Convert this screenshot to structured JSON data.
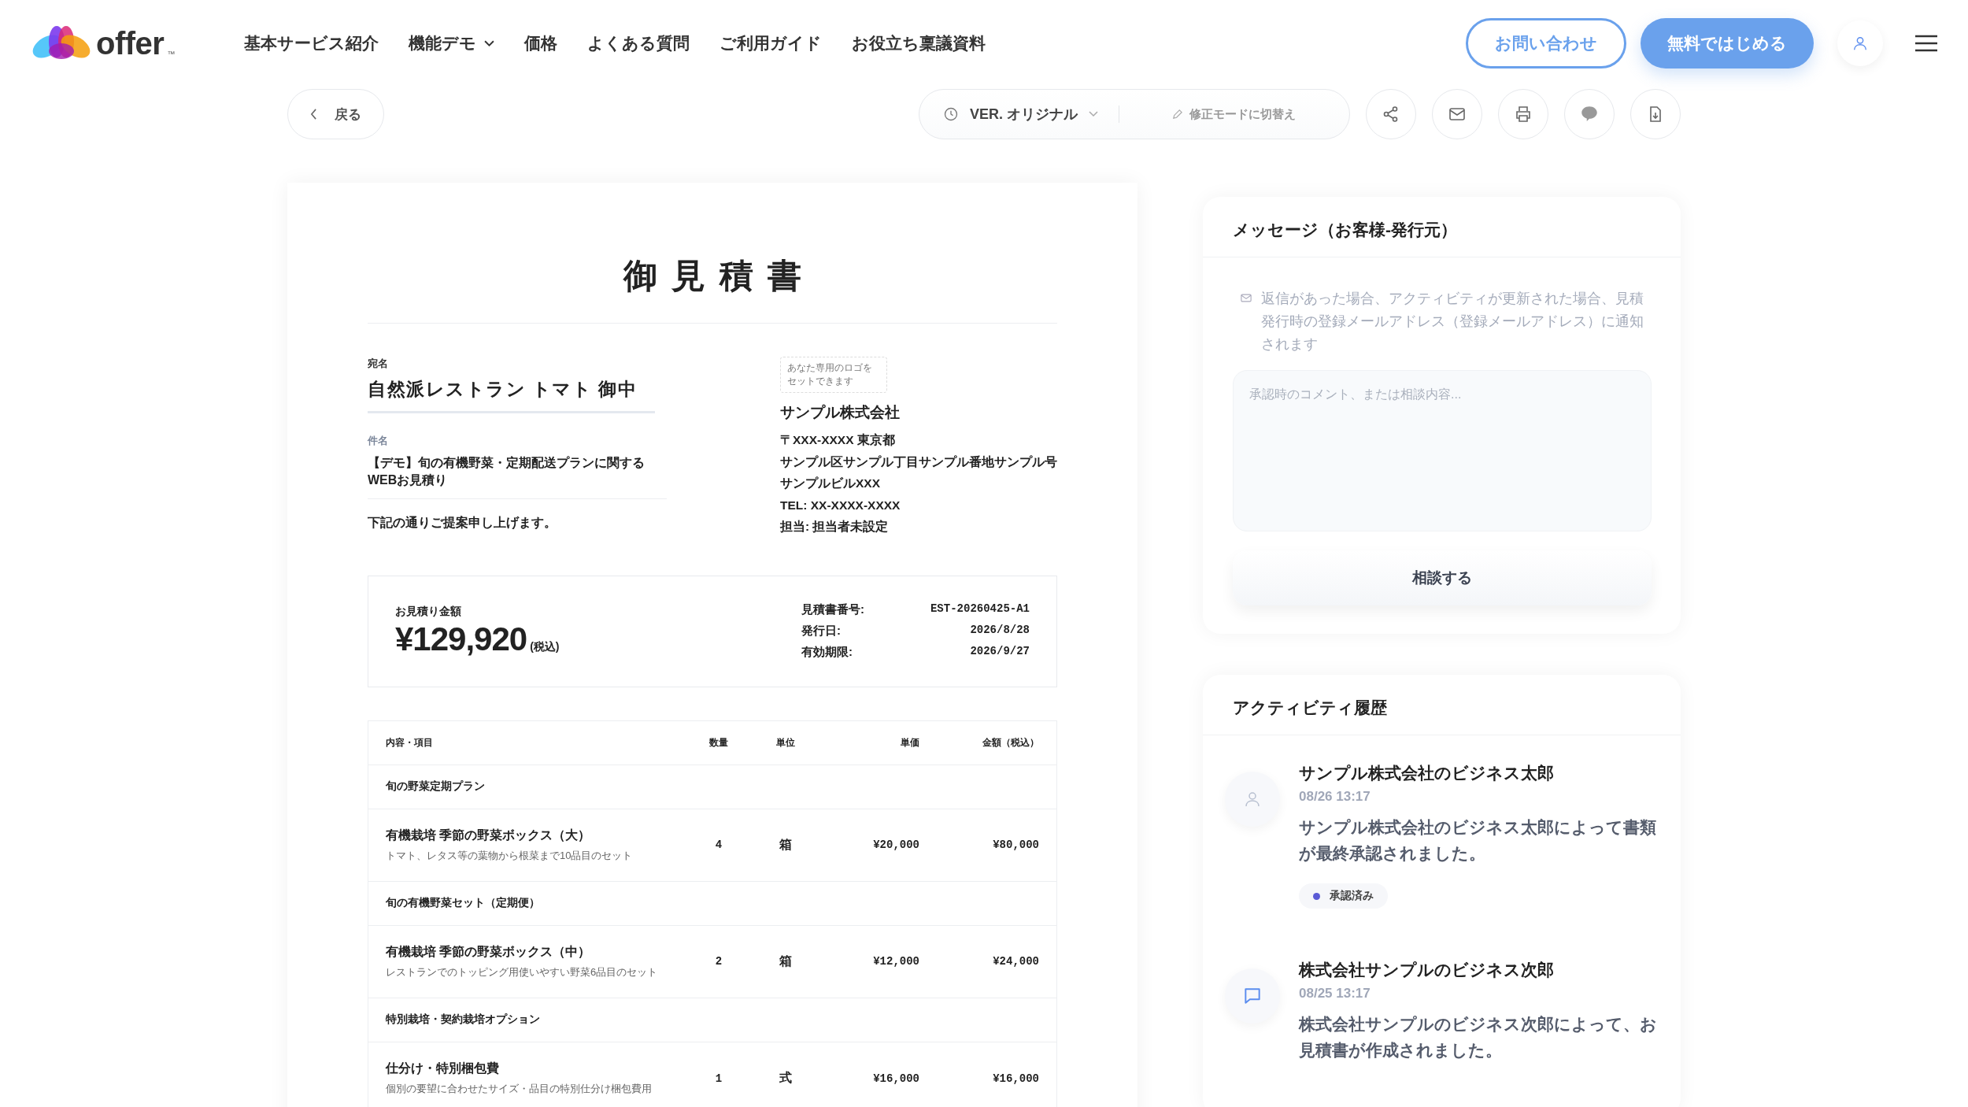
{
  "header": {
    "logo": "offer",
    "logo_mark": "™",
    "nav": [
      {
        "label": "基本サービス紹介",
        "has_menu": false
      },
      {
        "label": "機能デモ",
        "has_menu": true
      },
      {
        "label": "価格",
        "has_menu": false
      },
      {
        "label": "よくある質問",
        "has_menu": false
      },
      {
        "label": "ご利用ガイド",
        "has_menu": false
      },
      {
        "label": "お役立ち稟議資料",
        "has_menu": false
      }
    ],
    "contact_button": "お問い合わせ",
    "start_button": "無料ではじめる"
  },
  "toolbar": {
    "back": "戻る",
    "version": "VER. オリジナル",
    "edit_mode": "修正モードに切替え"
  },
  "document": {
    "title": "御見積書",
    "recipient_label": "宛名",
    "recipient": "自然派レストラン トマト 御中",
    "subject_label": "件名",
    "subject": "【デモ】旬の有機野菜・定期配送プランに関するWEBお見積り",
    "intro": "下記の通りご提案申し上げます。",
    "logo_placeholder": "あなた専用のロゴをセットできます",
    "company": "サンプル株式会社",
    "address_lines": [
      "〒XXX-XXXX 東京都",
      "サンプル区サンプル丁目サンプル番地サンプル号",
      "サンプルビルXXX",
      "TEL: XX-XXXX-XXXX",
      "担当: 担当者未設定"
    ],
    "amount_label": "お見積り金額",
    "amount": "¥129,920",
    "tax_note": "(税込)",
    "meta": [
      {
        "label": "見積書番号:",
        "value": "EST-20260425-A1"
      },
      {
        "label": "発行日:",
        "value": "2026/8/28"
      },
      {
        "label": "有効期限:",
        "value": "2026/9/27"
      }
    ],
    "table": {
      "columns": [
        "内容・項目",
        "数量",
        "単位",
        "単価",
        "金額（税込）"
      ],
      "rows": [
        {
          "kind": "group",
          "label": "旬の野菜定期プラン"
        },
        {
          "kind": "item",
          "name": "有機栽培 季節の野菜ボックス（大）",
          "note": "トマト、レタス等の葉物から根菜まで10品目のセット",
          "qty": "4",
          "unit": "箱",
          "price": "¥20,000",
          "amount": "¥80,000"
        },
        {
          "kind": "group",
          "label": "旬の有機野菜セット（定期便）"
        },
        {
          "kind": "item",
          "name": "有機栽培 季節の野菜ボックス（中）",
          "note": "レストランでのトッピング用使いやすい野菜6品目のセット",
          "qty": "2",
          "unit": "箱",
          "price": "¥12,000",
          "amount": "¥24,000"
        },
        {
          "kind": "group",
          "label": "特別栽培・契約栽培オプション"
        },
        {
          "kind": "item",
          "name": "仕分け・特別梱包費",
          "note": "個別の要望に合わせたサイズ・品目の特別仕分け梱包費用",
          "qty": "1",
          "unit": "式",
          "price": "¥16,000",
          "amount": "¥16,000"
        }
      ]
    }
  },
  "messages": {
    "title": "メッセージ（お客様-発行元）",
    "notice": "返信があった場合、アクティビティが更新された場合、見積発行時の登録メールアドレス（登録メールアドレス）に通知されます",
    "placeholder": "承認時のコメント、または相談内容...",
    "button": "相談する"
  },
  "activity": {
    "title": "アクティビティ履歴",
    "entries": [
      {
        "kind": "person",
        "name": "サンプル株式会社のビジネス太郎",
        "date": "08/26 13:17",
        "text": "サンプル株式会社のビジネス太郎によって書類が最終承認されました。",
        "status": {
          "label": "承認済み",
          "color": "#5b5bd6"
        }
      },
      {
        "kind": "comment",
        "name": "株式会社サンプルのビジネス次郎",
        "date": "08/25 13:17",
        "text": "株式会社サンプルのビジネス次郎によって、お見積書が作成されました。"
      }
    ]
  }
}
